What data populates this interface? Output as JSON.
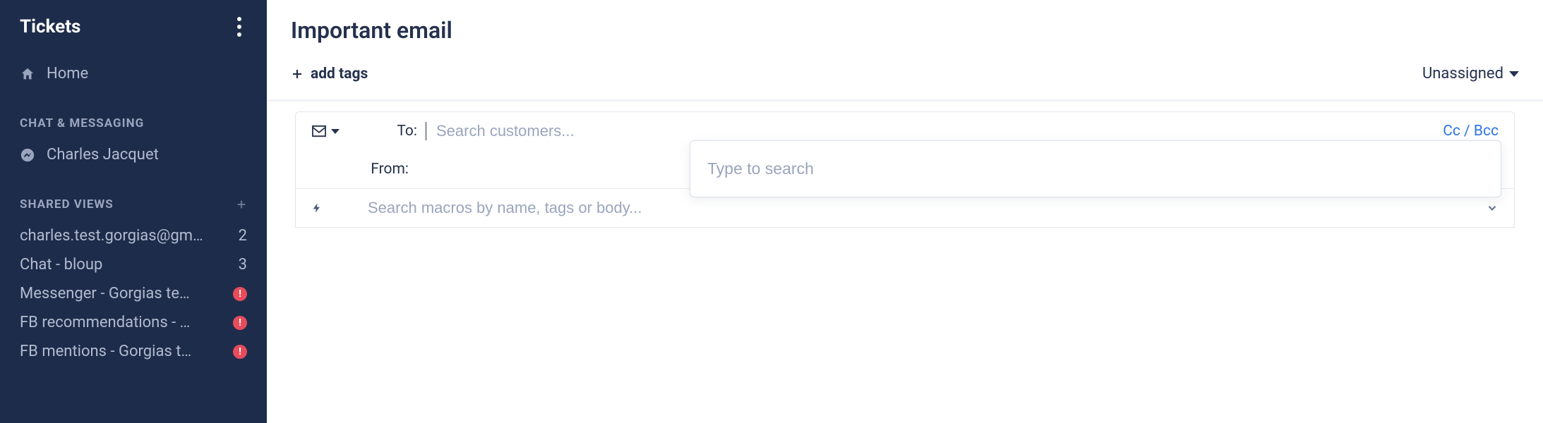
{
  "sidebar": {
    "title": "Tickets",
    "home": "Home",
    "sections": {
      "chat": {
        "header": "CHAT & MESSAGING",
        "items": [
          {
            "label": "Charles Jacquet"
          }
        ]
      },
      "shared": {
        "header": "SHARED VIEWS",
        "items": [
          {
            "label": "charles.test.gorgias@gm…",
            "count": "2"
          },
          {
            "label": "Chat - bloup",
            "count": "3"
          },
          {
            "label": "Messenger - Gorgias te…",
            "error": true
          },
          {
            "label": "FB recommendations - …",
            "error": true
          },
          {
            "label": "FB mentions - Gorgias t…",
            "error": true
          }
        ]
      }
    }
  },
  "page": {
    "title": "Important email",
    "add_tags": "add tags",
    "assignee": "Unassigned"
  },
  "compose": {
    "to_label": "To:",
    "to_placeholder": "Search customers...",
    "from_label": "From:",
    "ccbcc": "Cc / Bcc",
    "dropdown_placeholder": "Type to search",
    "macro_placeholder": "Search macros by name, tags or body..."
  }
}
